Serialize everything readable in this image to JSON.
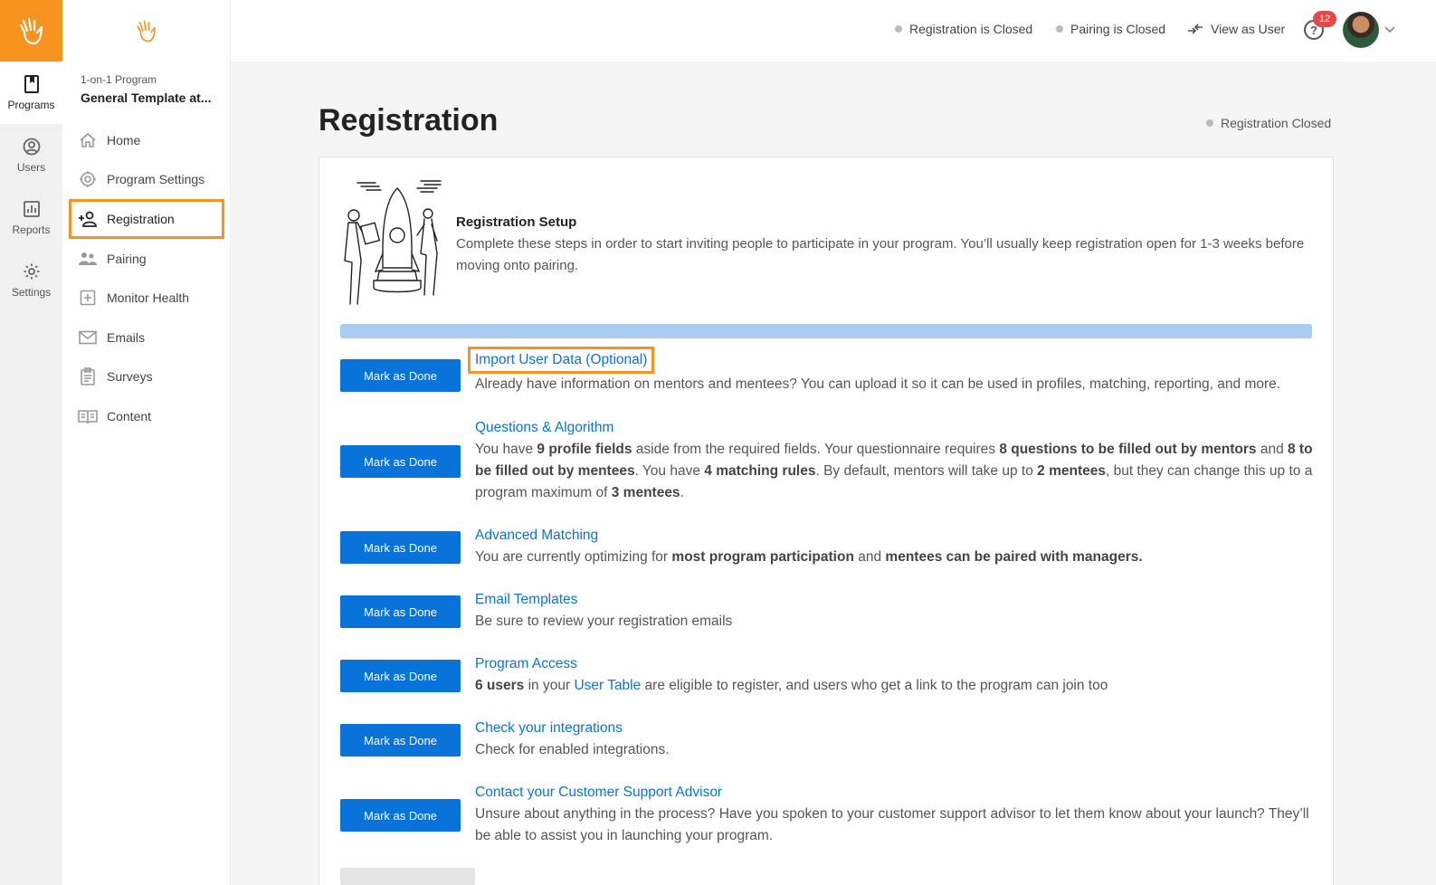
{
  "rail": {
    "items": [
      {
        "label": "Programs",
        "icon": "book-icon"
      },
      {
        "label": "Users",
        "icon": "user-circle-icon"
      },
      {
        "label": "Reports",
        "icon": "bar-chart-icon"
      },
      {
        "label": "Settings",
        "icon": "gear-icon"
      }
    ]
  },
  "program": {
    "type": "1-on-1 Program",
    "name": "General Template at..."
  },
  "nav": {
    "items": [
      {
        "label": "Home",
        "icon": "home-icon"
      },
      {
        "label": "Program Settings",
        "icon": "gear-icon"
      },
      {
        "label": "Registration",
        "icon": "add-user-icon"
      },
      {
        "label": "Pairing",
        "icon": "people-icon"
      },
      {
        "label": "Monitor Health",
        "icon": "plus-square-icon"
      },
      {
        "label": "Emails",
        "icon": "envelope-icon"
      },
      {
        "label": "Surveys",
        "icon": "clipboard-icon"
      },
      {
        "label": "Content",
        "icon": "open-book-icon"
      }
    ]
  },
  "topbar": {
    "registration_status": "Registration is Closed",
    "pairing_status": "Pairing is Closed",
    "view_as_user": "View as User",
    "help": "?",
    "notification_count": "12"
  },
  "page": {
    "title": "Registration",
    "status": "Registration Closed"
  },
  "setup": {
    "title": "Registration Setup",
    "description": "Complete these steps in order to start inviting people to participate in your program. You’ll usually keep registration open for 1-3 weeks before moving onto pairing."
  },
  "steps": {
    "button_label": "Mark as Done",
    "import": {
      "title": "Import User Data (Optional)",
      "desc": "Already have information on mentors and mentees? You can upload it so it can be used in profiles, matching, reporting, and more."
    },
    "questions": {
      "title": "Questions & Algorithm",
      "t1": "You have ",
      "b1": "9 profile fields",
      "t2": " aside from the required fields. Your questionnaire requires ",
      "b2": "8 questions to be filled out by mentors",
      "t3": " and ",
      "b3": "8 to be filled out by mentees",
      "t4": ". You have ",
      "b4": "4 matching rules",
      "t5": ". By default, mentors will take up to ",
      "b5": "2 mentees",
      "t6": ", but they can change this up to a program maximum of ",
      "b6": "3 mentees",
      "t7": "."
    },
    "advanced": {
      "title": "Advanced Matching",
      "t1": "You are currently optimizing for ",
      "b1": "most program participation",
      "t2": " and ",
      "b2": "mentees can be paired with managers."
    },
    "email": {
      "title": "Email Templates",
      "desc": "Be sure to review your registration emails"
    },
    "access": {
      "title": "Program Access",
      "b1": "6 users",
      "t1": " in your ",
      "link": "User Table",
      "t2": " are eligible to register, and users who get a link to the program can join too"
    },
    "integrations": {
      "title": "Check your integrations",
      "desc": "Check for enabled integrations."
    },
    "support": {
      "title": "Contact your Customer Support Advisor",
      "desc": "Unsure about anything in the process? Have you spoken to your customer support advisor to let them know about your launch? They’ll be able to assist you in launching your program."
    }
  },
  "colors": {
    "brand": "#f7931e",
    "primary": "#0a73d9",
    "progress": "#a8cdf0",
    "badge": "#e44848"
  }
}
